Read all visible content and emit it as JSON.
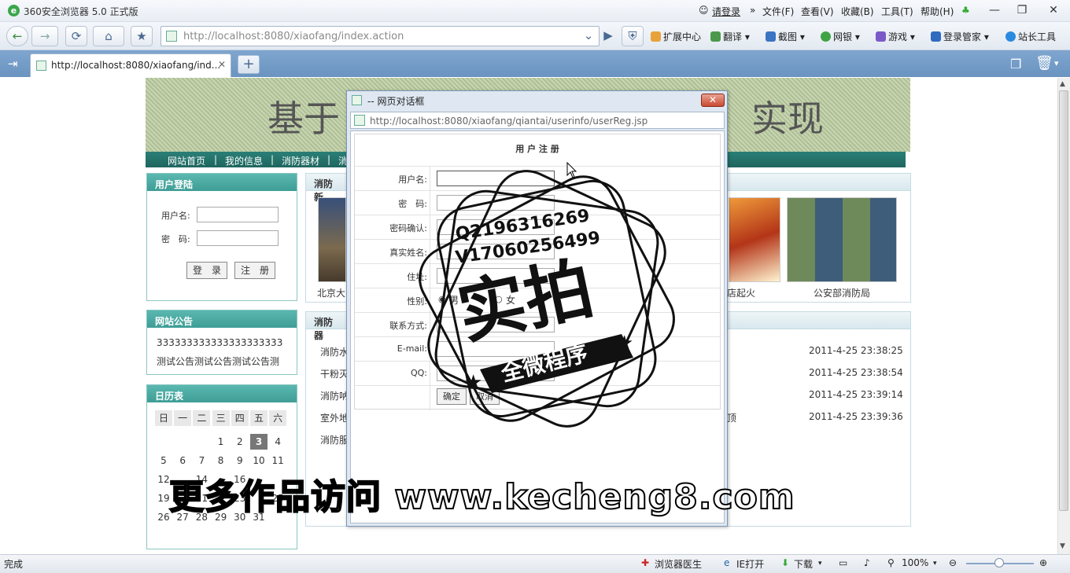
{
  "browser": {
    "title": "360安全浏览器 5.0 正式版",
    "login": "请登录",
    "menu": [
      "文件(F)",
      "查看(V)",
      "收藏(B)",
      "工具(T)",
      "帮助(H)"
    ],
    "address": "http://localhost:8080/xiaofang/index.action",
    "tools": [
      "扩展中心",
      "翻译",
      "截图",
      "网银",
      "游戏",
      "登录管家",
      "站长工具"
    ],
    "tab_title": "http://localhost:8080/xiaofang/ind...",
    "status": "完成",
    "status_items": [
      "浏览器医生",
      "IE打开",
      "下载"
    ],
    "zoom": "100%"
  },
  "page": {
    "banner_left": "基于",
    "banner_right": "实现",
    "nav": [
      "网站首页",
      "|",
      "我的信息",
      "|",
      "消防器材",
      "|",
      "消"
    ],
    "login_box": {
      "title": "用户登陆",
      "user_label": "用户名:",
      "pwd_label": "密　码:",
      "login_btn": "登　录",
      "reg_btn": "注　册"
    },
    "notice_box": {
      "title": "网站公告",
      "line1": "333333333333333333333",
      "line2": "测试公告测试公告测试公告测"
    },
    "calendar": {
      "title": "日历表",
      "weekdays": [
        "日",
        "一",
        "二",
        "三",
        "四",
        "五",
        "六"
      ],
      "rows": [
        [
          "",
          "",
          "",
          "1",
          "2",
          "3",
          "4"
        ],
        [
          "5",
          "6",
          "7",
          "8",
          "9",
          "10",
          "11"
        ],
        [
          "12",
          "",
          "14",
          "",
          "16",
          "",
          ""
        ],
        [
          "19",
          "",
          "21",
          "",
          "23",
          "",
          "25"
        ],
        [
          "26",
          "27",
          "28",
          "29",
          "30",
          "31",
          ""
        ]
      ],
      "today": "3"
    },
    "news": {
      "title": "消防新",
      "captions": [
        "北京大",
        "店起火",
        "公安部消防局"
      ]
    },
    "equipment": {
      "title": "消防器",
      "items": [
        "消防水",
        "干粉灭",
        "消防呐",
        "室外地",
        "消防服"
      ],
      "dates": [
        "2011-4-25 23:38:25",
        "2011-4-25 23:38:54",
        "2011-4-25 23:39:14",
        "2011-4-25 23:39:36"
      ],
      "suffix": "顶"
    }
  },
  "dialog": {
    "caption": "-- 网页对话框",
    "url": "http://localhost:8080/xiaofang/qiantai/userinfo/userReg.jsp",
    "form_title": "用 户 注 册",
    "fields": [
      "用户名:",
      "密　码:",
      "密码确认:",
      "真实姓名:",
      "住址:",
      "性别:",
      "联系方式:",
      "E-mail:",
      "QQ:"
    ],
    "gender_male": "男",
    "gender_female": "女",
    "ok": "确定",
    "cancel": "取消"
  },
  "watermark": {
    "stamp_line1": "Q2196316269",
    "stamp_line2": "V17060256499",
    "stamp_main": "实拍",
    "stamp_ribbon": "全微程序",
    "bottom": "更多作品访问 www.kecheng8.com"
  },
  "colors": {
    "accent": "#3e9d95",
    "nav": "#1f6660",
    "tabbar": "#6a93c0"
  }
}
